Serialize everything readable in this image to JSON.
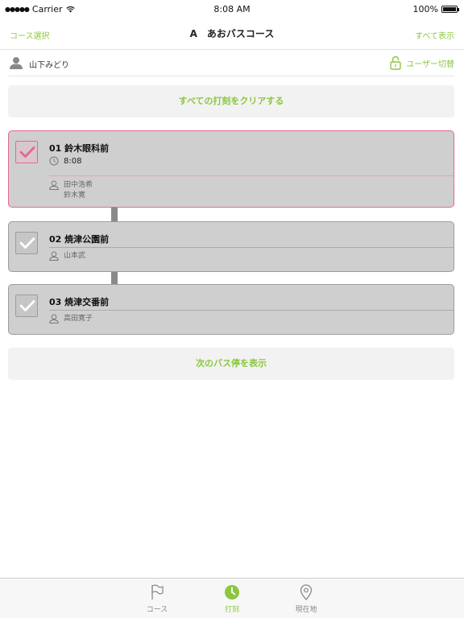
{
  "status_bar": {
    "carrier": "Carrier",
    "time": "8:08 AM",
    "battery": "100%"
  },
  "nav": {
    "left_label": "コース選択",
    "title": "A　あおバスコース",
    "right_label": "すべて表示"
  },
  "user": {
    "name": "山下みどり",
    "switch_label": "ユーザー切替"
  },
  "clear_button_label": "すべての打刻をクリアする",
  "stops": [
    {
      "title": "01  鈴木眼科前",
      "time": "8:08",
      "people": [
        "田中浩希",
        "鈴木寛"
      ],
      "checked": true
    },
    {
      "title": "02  焼津公園前",
      "people": [
        "山本武"
      ],
      "checked": false
    },
    {
      "title": "03  焼津交番前",
      "people": [
        "高田寛子"
      ],
      "checked": false
    }
  ],
  "next_button_label": "次のバス停を表示",
  "tabs": [
    {
      "label": "コース",
      "icon": "flag-icon"
    },
    {
      "label": "打刻",
      "icon": "clock-icon",
      "active": true
    },
    {
      "label": "現在地",
      "icon": "location-pin-icon"
    }
  ],
  "colors": {
    "accent_green": "#8cc63f",
    "active_pink": "#e06a8f",
    "card_gray": "#cfcfcf"
  }
}
